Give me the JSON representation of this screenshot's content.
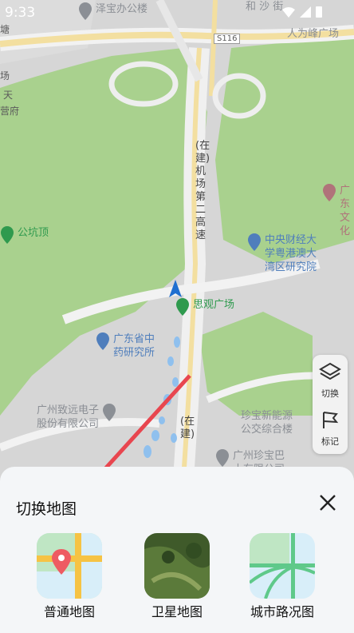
{
  "status_bar": {
    "time": "9:33"
  },
  "map": {
    "road_labels": [
      "S116"
    ],
    "pois": [
      {
        "name": "泽宝办公楼",
        "type": "gray"
      },
      {
        "name": "人为峰广场",
        "type": "gray"
      },
      {
        "name": "和 沙 街",
        "type": "gray"
      },
      {
        "name": "公坑顶",
        "type": "green"
      },
      {
        "name": "广东\n文化",
        "type": "red"
      },
      {
        "name": "中央财经大\n学粤港澳大\n湾区研究院",
        "type": "blue"
      },
      {
        "name": "思观广场",
        "type": "green"
      },
      {
        "name": "广东省中\n药研究所",
        "type": "blue"
      },
      {
        "name": "广州致远电子\n股份有限公司",
        "type": "gray"
      },
      {
        "name": "珍宝新能源\n公交综合楼",
        "type": "gray"
      },
      {
        "name": "广州珍宝巴\n士有限公司",
        "type": "gray"
      }
    ],
    "highway_label": "(在建)机场第二高速",
    "highway_label2": "(在建)",
    "edge_labels": [
      "塘",
      "场",
      "天",
      "营府"
    ]
  },
  "side_tools": [
    {
      "label": "切换",
      "icon": "layers-icon"
    },
    {
      "label": "标记",
      "icon": "flag-icon"
    }
  ],
  "switch_panel": {
    "title": "切换地图",
    "close_icon": "close-icon",
    "options": [
      {
        "label": "普通地图",
        "icon": "standard-map-thumbnail"
      },
      {
        "label": "卫星地图",
        "icon": "satellite-map-thumbnail"
      },
      {
        "label": "城市路况图",
        "icon": "traffic-map-thumbnail"
      }
    ]
  },
  "colors": {
    "green_area": "#a9d18e",
    "road": "#f2f2f2",
    "highway": "#f3dfa0",
    "panel_bg": "#f4f6f8",
    "arrow": "#e8464f"
  }
}
